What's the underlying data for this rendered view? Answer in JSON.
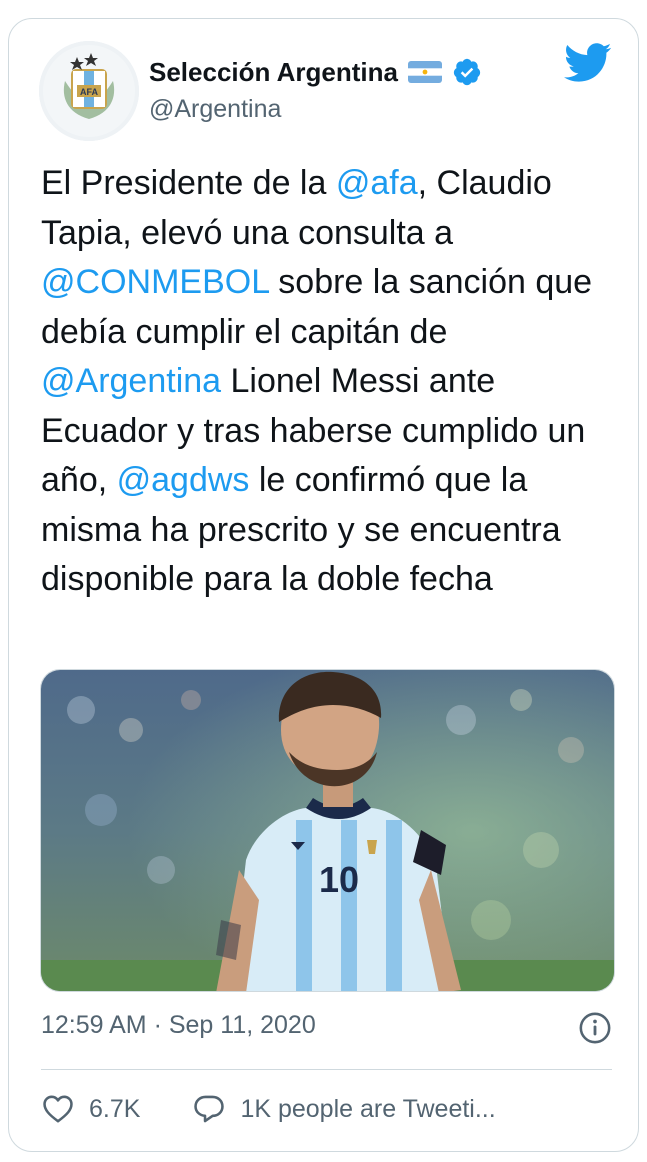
{
  "account": {
    "name": "Selección Argentina",
    "handle": "@Argentina",
    "avatar": "afa-crest-avatar",
    "flag": "argentina-flag-emoji",
    "verified_badge": "verified-icon"
  },
  "tweet": {
    "parts": [
      {
        "text": "El Presidente de la ",
        "mention": false
      },
      {
        "text": "@afa",
        "mention": true
      },
      {
        "text": ", Claudio Tapia, elevó una consulta a ",
        "mention": false
      },
      {
        "text": "@CONMEBOL",
        "mention": true
      },
      {
        "text": " sobre la sanción que debía cumplir el capitán de ",
        "mention": false
      },
      {
        "text": "@Argentina",
        "mention": true
      },
      {
        "text": " Lionel Messi ante Ecuador y tras haberse cumplido un año, ",
        "mention": false
      },
      {
        "text": "@agdws",
        "mention": true
      },
      {
        "text": " le confirmó que la misma ha prescrito y se encuentra disponible para la doble fecha",
        "mention": false
      }
    ],
    "timestamp": "12:59 AM · Sep 11, 2020"
  },
  "media": {
    "description": "player-photo",
    "jersey_number": "10"
  },
  "actions": {
    "likes": "6.7K",
    "talking": "1K people are Tweeti..."
  },
  "colors": {
    "accent": "#1d9bf0",
    "text": "#0f1419",
    "secondary": "#536471",
    "border": "#cfd9de"
  },
  "icons": [
    "twitter-bird-icon",
    "info-icon",
    "heart-icon",
    "reply-bubble-icon"
  ]
}
